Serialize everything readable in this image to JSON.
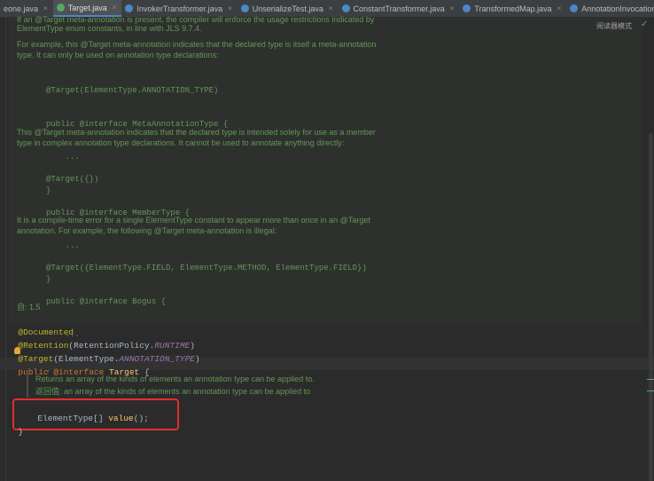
{
  "tabs": [
    {
      "label": "eone.java",
      "icon": "java-class-icon",
      "icon_color": "#e07b39",
      "closable": true
    },
    {
      "label": "Target.java",
      "icon": "annotation-icon",
      "icon_color": "#59a869",
      "closable": true,
      "active": true
    },
    {
      "label": "InvokerTransformer.java",
      "icon": "class-icon",
      "icon_color": "#4a88c7",
      "closable": true
    },
    {
      "label": "UnserializeTest.java",
      "icon": "class-icon",
      "icon_color": "#4a88c7",
      "closable": true
    },
    {
      "label": "ConstantTransformer.java",
      "icon": "class-icon",
      "icon_color": "#4a88c7",
      "closable": true
    },
    {
      "label": "TransformedMap.java",
      "icon": "class-icon",
      "icon_color": "#4a88c7",
      "closable": true
    },
    {
      "label": "AnnotationInvocationHandler.clas",
      "icon": "class-icon",
      "icon_color": "#4a88c7",
      "closable": false
    }
  ],
  "tab_overflow": "⌄",
  "reader_mode": "阅读器模式",
  "doc": {
    "top_partial": "If an @Target meta-annotation is present, the compiler will enforce the usage restrictions indicated by",
    "p0_line2": "ElementType enum constants, in line with JLS 9.7.4.",
    "p1": "For example, this @Target meta-annotation indicates that the declared type is itself a meta-annotation",
    "p1_line2": "type. It can only be used on annotation type declarations:",
    "ex1": [
      "@Target(ElementType.ANNOTATION_TYPE)",
      "public @interface MetaAnnotationType {",
      "    ...",
      "}"
    ],
    "p2": "This @Target meta-annotation indicates that the declared type is intended solely for use as a member",
    "p2_line2": "type in complex annotation type declarations. It cannot be used to annotate anything directly:",
    "ex2": [
      "@Target({})",
      "public @interface MemberType {",
      "    ...",
      "}"
    ],
    "p3": "It is a compile-time error for a single ElementType constant to appear more than once in an @Target",
    "p3_line2": "annotation. For example, the following @Target meta-annotation is illegal:",
    "ex3": [
      "@Target({ElementType.FIELD, ElementType.METHOD, ElementType.FIELD})",
      "public @interface Bogus {",
      "    ...",
      "}"
    ],
    "since": "自: 1.5"
  },
  "code": {
    "l1": "@Documented",
    "l2_a": "@Retention",
    "l2_b": "(RetentionPolicy.",
    "l2_c": "RUNTIME",
    "l2_d": ")",
    "l3_a": "@Target",
    "l3_b": "(ElementType.",
    "l3_c": "ANNOTATION_TYPE",
    "l3_d": ")",
    "l4_a": "public ",
    "l4_b": "@interface ",
    "l4_c": "Target",
    "l4_d": " {",
    "inline_doc_1": "Returns an array of the kinds of elements an annotation type can be applied to.",
    "inline_doc_2": "返回值: an array of the kinds of elements an annotation type can be applied to",
    "l5_a": "ElementType[] ",
    "l5_b": "value",
    "l5_c": "();",
    "l6": "}"
  }
}
